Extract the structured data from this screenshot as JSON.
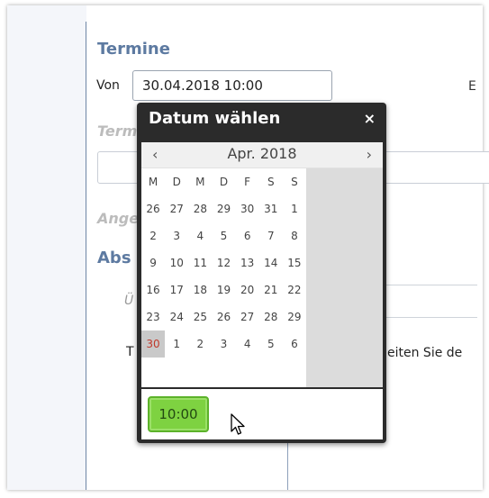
{
  "section": {
    "termine_title": "Termine",
    "absatz_title_fragment": "Abs"
  },
  "von": {
    "label": "Von",
    "value": "30.04.2018 10:00",
    "right_fragment": "E"
  },
  "termin_label_fragment": "Term",
  "ange_label_fragment": "Ange",
  "u_label_fragment": "Ü",
  "text_line": {
    "left_fragment": "T",
    "right_fragment": "eiten Sie de"
  },
  "picker": {
    "title": "Datum wählen",
    "close_glyph": "×",
    "prev_glyph": "‹",
    "next_glyph": "›",
    "month": "Apr. 2018",
    "weekdays": [
      "M",
      "D",
      "M",
      "D",
      "F",
      "S",
      "S"
    ],
    "weeks": [
      [
        "26",
        "27",
        "28",
        "29",
        "30",
        "31",
        "1"
      ],
      [
        "2",
        "3",
        "4",
        "5",
        "6",
        "7",
        "8"
      ],
      [
        "9",
        "10",
        "11",
        "12",
        "13",
        "14",
        "15"
      ],
      [
        "16",
        "17",
        "18",
        "19",
        "20",
        "21",
        "22"
      ],
      [
        "23",
        "24",
        "25",
        "26",
        "27",
        "28",
        "29"
      ],
      [
        "30",
        "1",
        "2",
        "3",
        "4",
        "5",
        "6"
      ]
    ],
    "today": "30",
    "time": "10:00"
  },
  "colors": {
    "section_title": "#5d7aa1",
    "today_text": "#c0392b",
    "time_button": "#7ed241",
    "picker_bg": "#2b2b2b"
  }
}
